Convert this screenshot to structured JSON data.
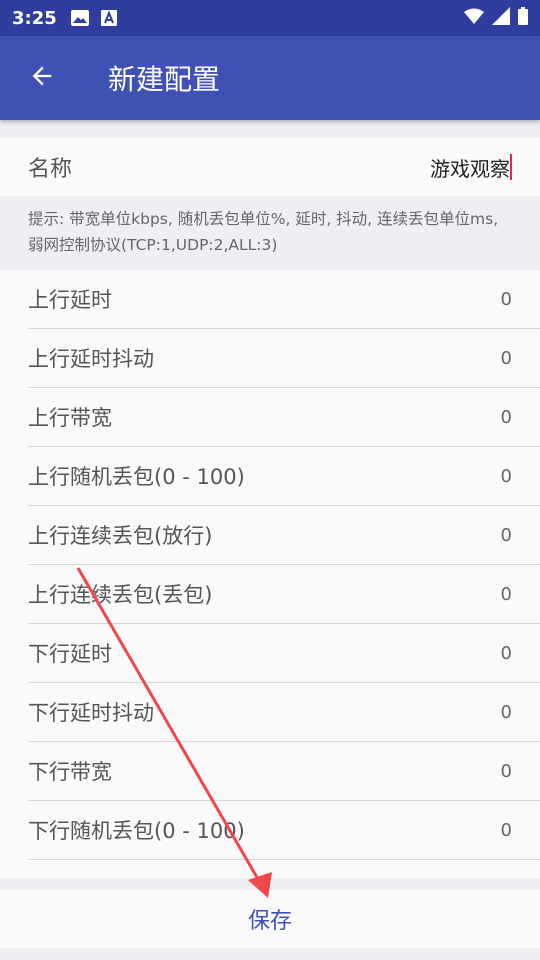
{
  "statusbar": {
    "time": "3:25",
    "icons_left": [
      "image-icon",
      "a-notification-icon"
    ],
    "icons_right": [
      "wifi-icon",
      "signal-icon",
      "battery-icon"
    ]
  },
  "appbar": {
    "title": "新建配置",
    "back_icon": "arrow-left-icon"
  },
  "form": {
    "name_label": "名称",
    "name_value": "游戏观察",
    "hint": "提示: 带宽单位kbps, 随机丢包单位%, 延时, 抖动, 连续丢包单位ms, 弱网控制协议(TCP:1,UDP:2,ALL:3)",
    "rows": [
      {
        "label": "上行延时",
        "value": "0"
      },
      {
        "label": "上行延时抖动",
        "value": "0"
      },
      {
        "label": "上行带宽",
        "value": "0"
      },
      {
        "label": "上行随机丢包(0 - 100)",
        "value": "0"
      },
      {
        "label": "上行连续丢包(放行)",
        "value": "0"
      },
      {
        "label": "上行连续丢包(丢包)",
        "value": "0"
      },
      {
        "label": "下行延时",
        "value": "0"
      },
      {
        "label": "下行延时抖动",
        "value": "0"
      },
      {
        "label": "下行带宽",
        "value": "0"
      },
      {
        "label": "下行随机丢包(0 - 100)",
        "value": "0"
      }
    ]
  },
  "save_label": "保存",
  "annotation": {
    "color": "#f0474a"
  },
  "colors": {
    "primary": "#3f51b5",
    "status": "#2f3e9e",
    "cursor": "#e91e63"
  }
}
